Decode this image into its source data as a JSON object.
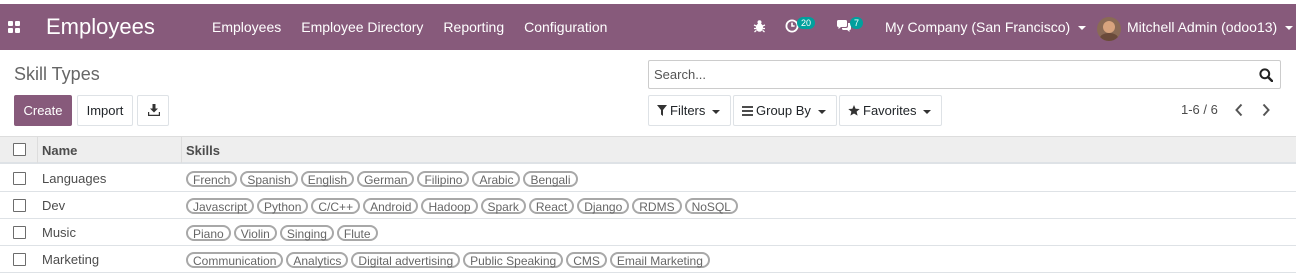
{
  "navbar": {
    "app_title": "Employees",
    "menu": [
      "Employees",
      "Employee Directory",
      "Reporting",
      "Configuration"
    ],
    "activity_count": "20",
    "messages_count": "7",
    "company": "My Company (San Francisco)",
    "user": "Mitchell Admin (odoo13)",
    "accent_color": "#875a7b",
    "badge_color": "#00a09d"
  },
  "control_panel": {
    "title": "Skill Types",
    "create_label": "Create",
    "import_label": "Import",
    "search_placeholder": "Search...",
    "filters_label": "Filters",
    "groupby_label": "Group By",
    "favorites_label": "Favorites",
    "pager": "1-6 / 6"
  },
  "table": {
    "headers": [
      "Name",
      "Skills"
    ],
    "rows": [
      {
        "name": "Languages",
        "skills": [
          "French",
          "Spanish",
          "English",
          "German",
          "Filipino",
          "Arabic",
          "Bengali"
        ]
      },
      {
        "name": "Dev",
        "skills": [
          "Javascript",
          "Python",
          "C/C++",
          "Android",
          "Hadoop",
          "Spark",
          "React",
          "Django",
          "RDMS",
          "NoSQL"
        ]
      },
      {
        "name": "Music",
        "skills": [
          "Piano",
          "Violin",
          "Singing",
          "Flute"
        ]
      },
      {
        "name": "Marketing",
        "skills": [
          "Communication",
          "Analytics",
          "Digital advertising",
          "Public Speaking",
          "CMS",
          "Email Marketing"
        ]
      }
    ]
  }
}
